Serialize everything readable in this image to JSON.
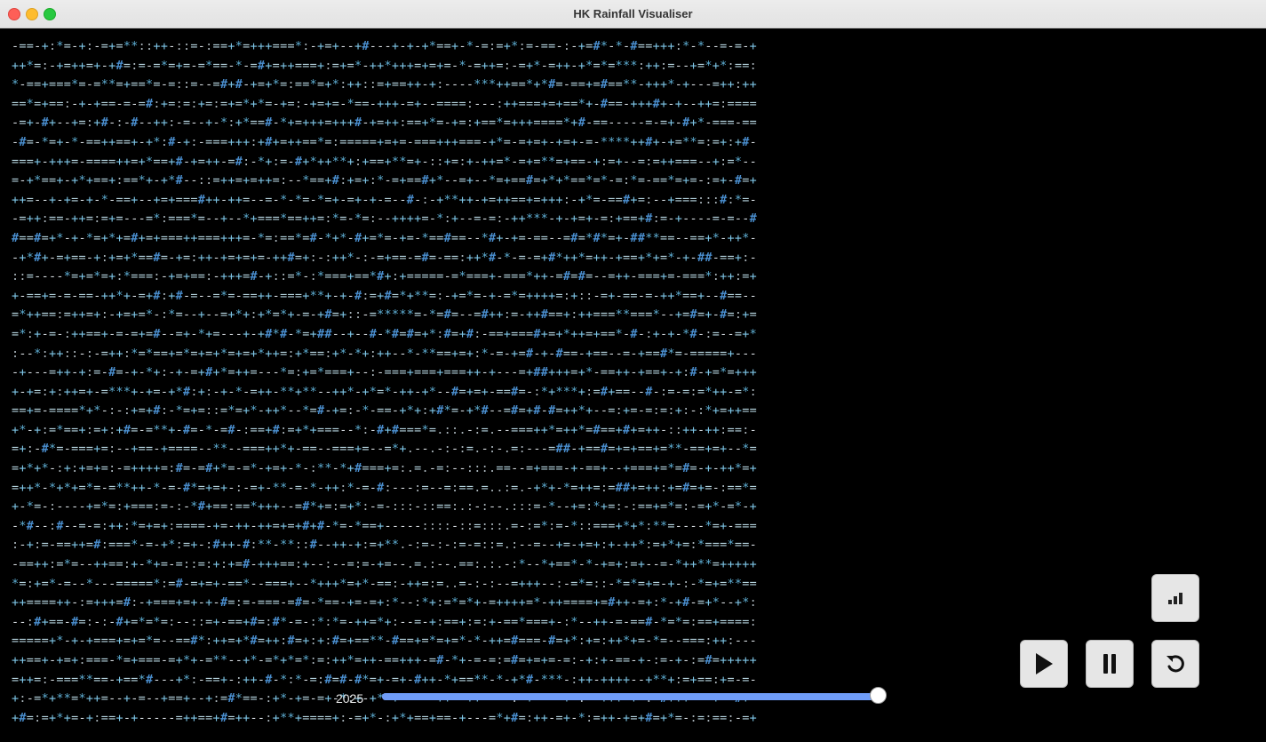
{
  "window": {
    "title": "HK Rainfall Visualiser"
  },
  "ascii_art": {
    "row_count": 36,
    "chars_per_row": 100,
    "glyphs": [
      "+",
      "*",
      "#",
      "=",
      "-",
      ":",
      "."
    ],
    "colors": {
      "plus": "#7fc7e8",
      "star": "#5fb0d6",
      "hash": "#4a8fd0",
      "equals": "#b6d5e0",
      "dash": "#d5dbe0",
      "colon": "#a9b4ba"
    }
  },
  "timeline": {
    "year_label": "2025",
    "position_fraction": 1.0,
    "track_color": "#6f9cf8"
  },
  "controls": {
    "stats": {
      "icon": "bar-chart-icon"
    },
    "play": {
      "icon": "play-icon"
    },
    "pause": {
      "icon": "pause-icon"
    },
    "reset": {
      "icon": "reset-icon"
    }
  }
}
